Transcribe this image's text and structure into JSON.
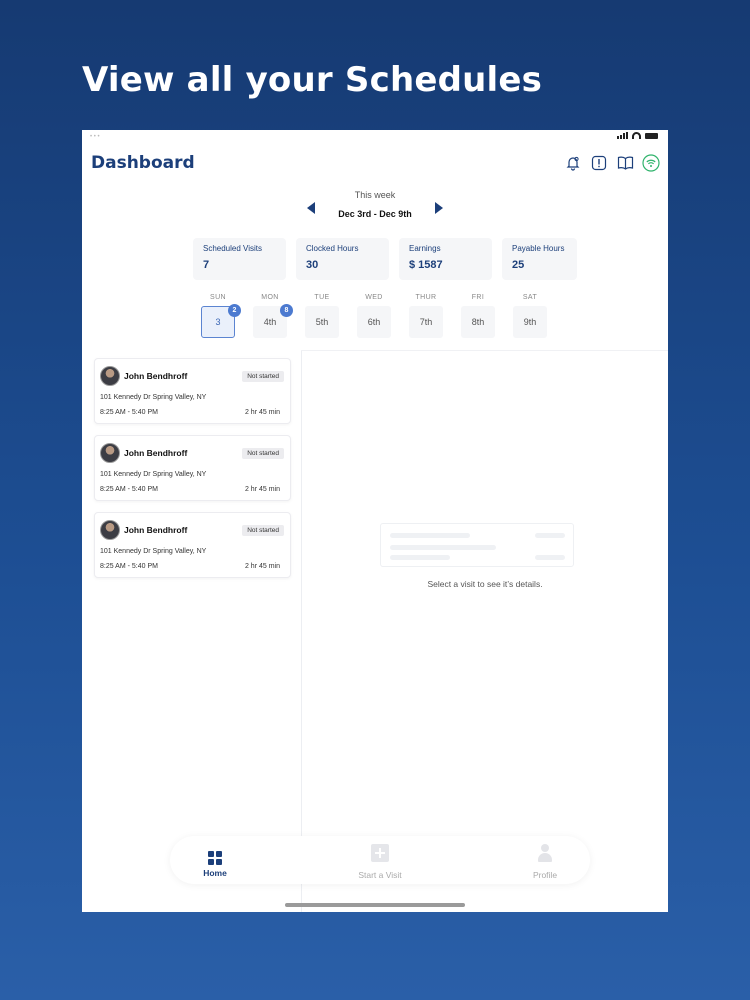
{
  "headline": "View all your Schedules",
  "header": {
    "title": "Dashboard"
  },
  "icons": {
    "bell": "bell-icon",
    "alert": "alert-icon",
    "book": "book-icon",
    "wifi": "wifi-icon",
    "wifi_color": "#2fb36b"
  },
  "week": {
    "label": "This week",
    "range": "Dec 3rd -  Dec 9th"
  },
  "stats": [
    {
      "label": "Scheduled Visits",
      "value": "7"
    },
    {
      "label": "Clocked Hours",
      "value": "30"
    },
    {
      "label": "Earnings",
      "value": "$ 1587"
    },
    {
      "label": "Payable Hours",
      "value": "25"
    }
  ],
  "days": [
    {
      "name": "SUN",
      "num": "3",
      "badge": "2",
      "active": true
    },
    {
      "name": "MON",
      "num": "4th",
      "badge": "8"
    },
    {
      "name": "TUE",
      "num": "5th"
    },
    {
      "name": "WED",
      "num": "6th"
    },
    {
      "name": "THUR",
      "num": "7th"
    },
    {
      "name": "FRI",
      "num": "8th"
    },
    {
      "name": "SAT",
      "num": "9th"
    }
  ],
  "visits": [
    {
      "name": "John Bendhroff",
      "status": "Not started",
      "address": "101 Kennedy Dr Spring Valley, NY",
      "time": "8:25 AM - 5:40 PM",
      "duration": "2 hr 45 min"
    },
    {
      "name": "John Bendhroff",
      "status": "Not started",
      "address": "101 Kennedy Dr Spring Valley, NY",
      "time": "8:25 AM - 5:40 PM",
      "duration": "2 hr 45 min"
    },
    {
      "name": "John Bendhroff",
      "status": "Not started",
      "address": "101 Kennedy Dr Spring Valley, NY",
      "time": "8:25 AM - 5:40 PM",
      "duration": "2 hr 45 min"
    }
  ],
  "detail": {
    "empty_message": "Select a visit to see it’s details."
  },
  "tabbar": {
    "home": "Home",
    "start": "Start a Visit",
    "profile": "Profile"
  },
  "colors": {
    "brand": "#1c3f7a",
    "accent": "#4c7ad0",
    "background_top": "#163a72",
    "background_bottom": "#2a5fa8"
  }
}
